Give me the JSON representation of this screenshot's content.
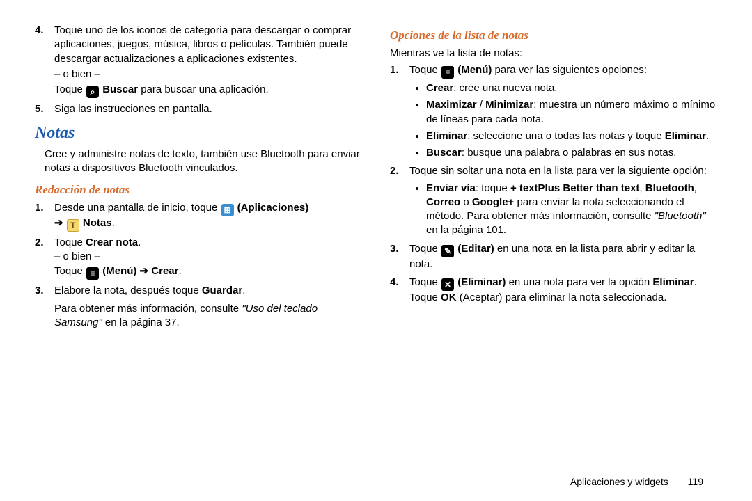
{
  "col1": {
    "s4": {
      "num": "4.",
      "text": "Toque uno de los iconos de categoría para descargar o comprar aplicaciones, juegos, música, libros o películas. También puede descargar actualizaciones a aplicaciones existentes.",
      "or": "– o bien –",
      "search_pre": "Toque ",
      "search_bold": " Buscar",
      "search_post": " para buscar una aplicación."
    },
    "s5": {
      "num": "5.",
      "text": "Siga las instrucciones en pantalla."
    },
    "h_notas": "Notas",
    "notas_intro": "Cree y administre notas de texto, también use Bluetooth para enviar notas a dispositivos Bluetooth vinculados.",
    "h_redaccion": "Redacción de notas",
    "r1": {
      "num": "1.",
      "pre": "Desde una pantalla de inicio, toque ",
      "apps_bold": " (Aplicaciones)",
      "arrow": "➔ ",
      "notas_bold": " Notas",
      "dot": "."
    },
    "r2": {
      "num": "2.",
      "pre": "Toque ",
      "bold": "Crear nota",
      "dot": ".",
      "or": "– o bien –",
      "menu_pre": "Toque ",
      "menu_bold": " (Menú) ➔ Crear",
      "menu_dot": "."
    },
    "r3": {
      "num": "3.",
      "pre": "Elabore la nota, después toque ",
      "bold": "Guardar",
      "dot": "."
    },
    "tail_pre": "Para obtener más información, consulte ",
    "tail_ital": "\"Uso del teclado Samsung\"",
    "tail_post": " en la página 37."
  },
  "col2": {
    "h_opciones": "Opciones de la lista de notas",
    "intro": "Mientras ve la lista de notas:",
    "o1": {
      "num": "1.",
      "pre": "Toque ",
      "bold": " (Menú)",
      "post": " para ver las siguientes opciones:",
      "b_crear_bold": "Crear",
      "b_crear_post": ": cree una nueva nota.",
      "b_max_bold": "Maximizar",
      "b_slash": " / ",
      "b_min_bold": "Minimizar",
      "b_max_post": ": muestra un número máximo o mínimo de líneas para cada nota.",
      "b_elim_bold": "Eliminar",
      "b_elim_mid": ": seleccione una o todas las notas y toque ",
      "b_elim_bold2": "Eliminar",
      "b_elim_dot": ".",
      "b_bus_bold": "Buscar",
      "b_bus_post": ": busque una palabra o palabras en sus notas."
    },
    "o2": {
      "num": "2.",
      "text": "Toque sin soltar una nota en la lista para ver la siguiente opción:",
      "b_env_bold": "Enviar vía",
      "b_env_mid": ": toque ",
      "b_env_plus": "+ textPlus Better than text",
      "b_env_comma": ", ",
      "b_env_bt": "Bluetooth",
      "b_env_comma2": ", ",
      "b_env_correo": "Correo",
      "b_env_o": " o ",
      "b_env_gplus": "Google+",
      "b_env_tail": " para enviar la nota seleccionando el método. Para obtener más información, consulte ",
      "b_env_ital": "\"Bluetooth\"",
      "b_env_page": " en la página 101."
    },
    "o3": {
      "num": "3.",
      "pre": "Toque ",
      "bold": " (Editar)",
      "post": " en una nota en la lista para abrir y editar la nota."
    },
    "o4": {
      "num": "4.",
      "pre": "Toque ",
      "bold": " (Eliminar)",
      "mid": " en una nota para ver la opción ",
      "bold2": "Eliminar",
      "mid2": ". Toque ",
      "bold3": "OK",
      "post": " (Aceptar) para eliminar la nota seleccionada."
    }
  },
  "footer": {
    "section": "Aplicaciones y widgets",
    "page": "119"
  },
  "icons": {
    "search_glyph": "⌕",
    "apps_glyph": "⊞",
    "notes_glyph": "T",
    "menu_glyph": "≡",
    "edit_glyph": "✎",
    "close_glyph": "✕"
  }
}
